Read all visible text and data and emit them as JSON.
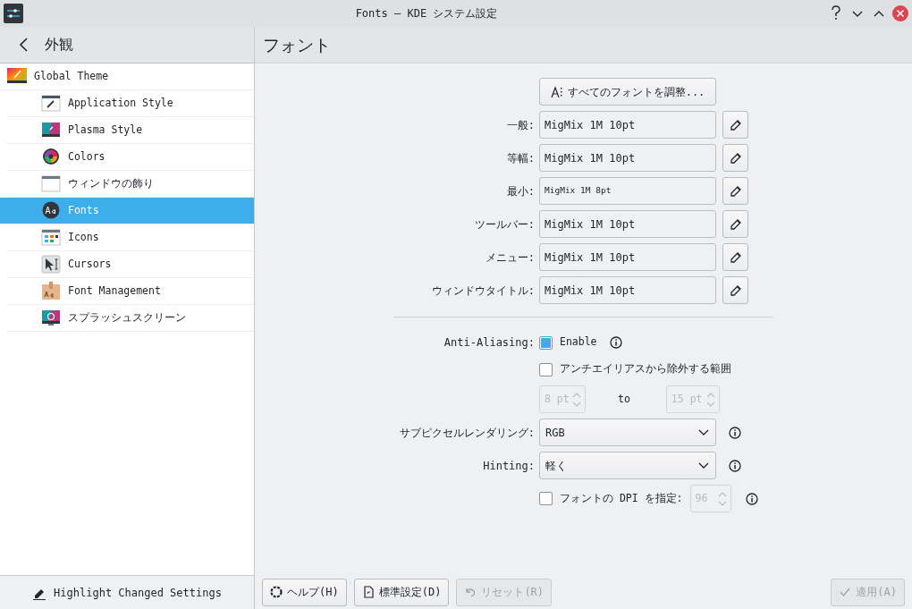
{
  "window": {
    "title": "Fonts — KDE システム設定"
  },
  "sidebar": {
    "back_label": "外観",
    "items": [
      {
        "label": "Global Theme",
        "selected": false,
        "kind": "theme",
        "children": [
          {
            "label": "Application Style",
            "selected": false,
            "kind": "appstyle"
          },
          {
            "label": "Plasma Style",
            "selected": false,
            "kind": "plasma"
          },
          {
            "label": "Colors",
            "selected": false,
            "kind": "colors"
          },
          {
            "label": "ウィンドウの飾り",
            "selected": false,
            "kind": "window"
          },
          {
            "label": "Fonts",
            "selected": true,
            "kind": "fonts"
          },
          {
            "label": "Icons",
            "selected": false,
            "kind": "icons"
          },
          {
            "label": "Cursors",
            "selected": false,
            "kind": "cursors"
          },
          {
            "label": "Font Management",
            "selected": false,
            "kind": "fontmgmt"
          },
          {
            "label": "スプラッシュスクリーン",
            "selected": false,
            "kind": "splash"
          }
        ]
      }
    ],
    "footer_button": "Highlight Changed Settings"
  },
  "page": {
    "title": "フォント",
    "adjust_all_button": "すべてのフォントを調整...",
    "font_rows": [
      {
        "label": "一般:",
        "value": "MigMix 1M 10pt",
        "kind": "normal"
      },
      {
        "label": "等幅:",
        "value": "MigMix 1M 10pt",
        "kind": "normal"
      },
      {
        "label": "最小:",
        "value": "MigMix 1M 8pt",
        "kind": "small"
      },
      {
        "label": "ツールバー:",
        "value": "MigMix 1M 10pt",
        "kind": "normal"
      },
      {
        "label": "メニュー:",
        "value": "MigMix 1M 10pt",
        "kind": "normal"
      },
      {
        "label": "ウィンドウタイトル:",
        "value": "MigMix 1M 10pt",
        "kind": "normal"
      }
    ],
    "anti_aliasing": {
      "label": "Anti-Aliasing:",
      "enable_label": "Enable",
      "enable_checked": true,
      "exclude_label": "アンチエイリアスから除外する範囲",
      "exclude_checked": false,
      "range_from": "8 pt",
      "range_to_label": "to",
      "range_to": "15 pt"
    },
    "subpixel": {
      "label": "サブピクセルレンダリング:",
      "value": "RGB"
    },
    "hinting": {
      "label": "Hinting:",
      "value": "軽く"
    },
    "dpi": {
      "label": "フォントの DPI を指定:",
      "checked": false,
      "value": "96"
    }
  },
  "buttons": [
    {
      "label": "ヘルプ(H)",
      "kind": "help",
      "disabled": false
    },
    {
      "label": "標準設定(D)",
      "kind": "defaults",
      "disabled": false
    },
    {
      "label": "リセット(R)",
      "kind": "reset",
      "disabled": true
    },
    {
      "label": "適用(A)",
      "kind": "apply",
      "disabled": true
    }
  ]
}
